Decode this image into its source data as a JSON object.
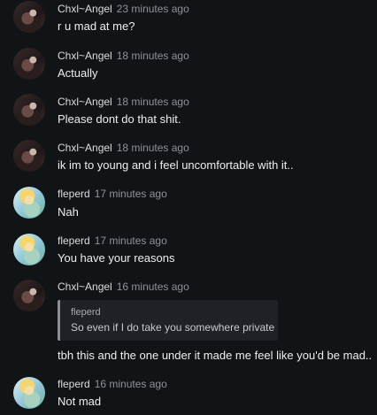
{
  "messages": [
    {
      "author": "Chxl~Angel",
      "time": "23 minutes ago",
      "text": "r u mad at me?",
      "avatar": "chxl-avatar"
    },
    {
      "author": "Chxl~Angel",
      "time": "18 minutes ago",
      "text": "Actually",
      "avatar": "chxl-avatar"
    },
    {
      "author": "Chxl~Angel",
      "time": "18 minutes ago",
      "text": "Please dont do that shit.",
      "avatar": "chxl-avatar"
    },
    {
      "author": "Chxl~Angel",
      "time": "18 minutes ago",
      "text": "ik im to young and i feel uncomfortable with it..",
      "avatar": "chxl-avatar"
    },
    {
      "author": "fleperd",
      "time": "17 minutes ago",
      "text": "Nah",
      "avatar": "fleperd-avatar"
    },
    {
      "author": "fleperd",
      "time": "17 minutes ago",
      "text": "You have your reasons",
      "avatar": "fleperd-avatar"
    },
    {
      "author": "Chxl~Angel",
      "time": "16 minutes ago",
      "text": "tbh this and the one under it made me feel like you'd be mad..",
      "avatar": "chxl-avatar",
      "quote": {
        "author": "fleperd",
        "text": "So even if I do take you somewhere private"
      }
    },
    {
      "author": "fleperd",
      "time": "16 minutes ago",
      "text": "Not mad",
      "avatar": "fleperd-avatar"
    }
  ],
  "colors": {
    "background": "#111416",
    "quote_bar": "#8b8f94",
    "quote_bg": "#1e2226"
  }
}
